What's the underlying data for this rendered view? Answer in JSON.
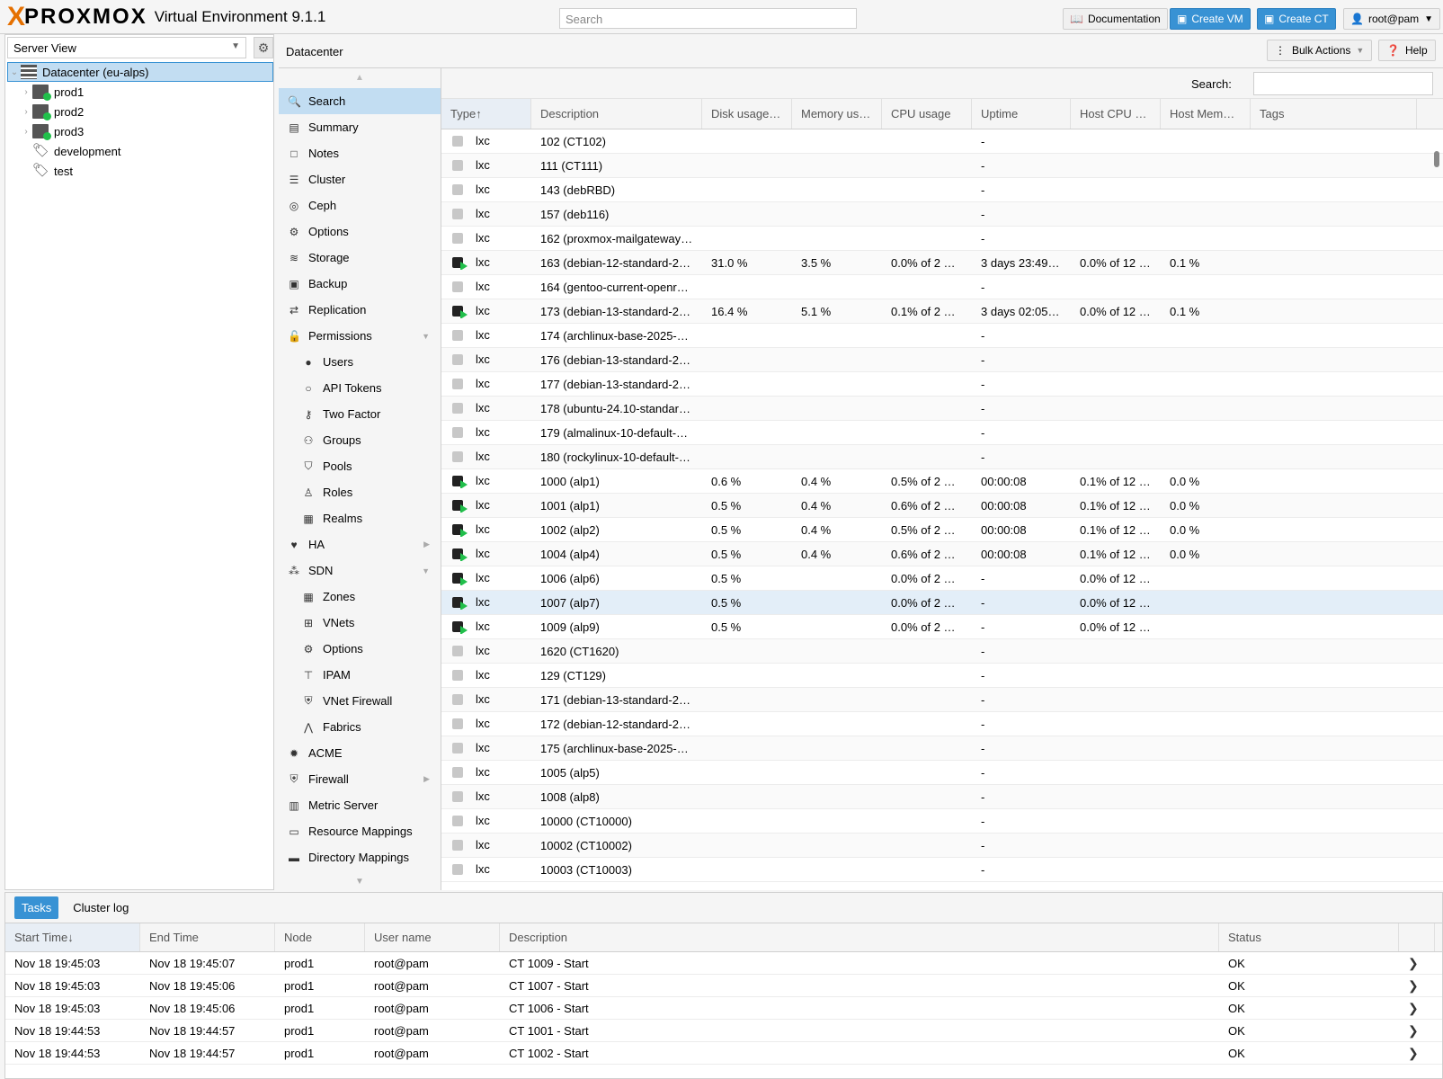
{
  "header": {
    "brand_x": "X",
    "brand": "PROXMOX",
    "product": "Virtual Environment 9.1.1",
    "search_placeholder": "Search",
    "documentation": "Documentation",
    "create_vm": "Create VM",
    "create_ct": "Create CT",
    "user": "root@pam"
  },
  "left": {
    "view": "Server View",
    "tree": [
      {
        "label": "Datacenter (eu-alps)",
        "type": "datacenter"
      },
      {
        "label": "prod1",
        "type": "node"
      },
      {
        "label": "prod2",
        "type": "node"
      },
      {
        "label": "prod3",
        "type": "node"
      },
      {
        "label": "development",
        "type": "tag"
      },
      {
        "label": "test",
        "type": "tag"
      }
    ]
  },
  "center": {
    "title": "Datacenter",
    "bulk_actions": "Bulk Actions",
    "help": "Help"
  },
  "menu": [
    {
      "label": "Search",
      "icon": "search-icon",
      "sel": true
    },
    {
      "label": "Summary",
      "icon": "book-icon"
    },
    {
      "label": "Notes",
      "icon": "notes-icon"
    },
    {
      "label": "Cluster",
      "icon": "server-icon"
    },
    {
      "label": "Ceph",
      "icon": "ceph-icon"
    },
    {
      "label": "Options",
      "icon": "gear-icon"
    },
    {
      "label": "Storage",
      "icon": "database-icon"
    },
    {
      "label": "Backup",
      "icon": "floppy-icon"
    },
    {
      "label": "Replication",
      "icon": "retweet-icon"
    },
    {
      "label": "Permissions",
      "icon": "unlock-icon",
      "tri": "down"
    },
    {
      "label": "Users",
      "icon": "user-icon",
      "sub": true
    },
    {
      "label": "API Tokens",
      "icon": "user-outline-icon",
      "sub": true
    },
    {
      "label": "Two Factor",
      "icon": "key-icon",
      "sub": true
    },
    {
      "label": "Groups",
      "icon": "users-icon",
      "sub": true
    },
    {
      "label": "Pools",
      "icon": "tags-icon",
      "sub": true
    },
    {
      "label": "Roles",
      "icon": "male-icon",
      "sub": true
    },
    {
      "label": "Realms",
      "icon": "id-card-icon",
      "sub": true
    },
    {
      "label": "HA",
      "icon": "heartbeat-icon",
      "tri": "right"
    },
    {
      "label": "SDN",
      "icon": "sdn-icon",
      "tri": "down"
    },
    {
      "label": "Zones",
      "icon": "grid-icon",
      "sub": true
    },
    {
      "label": "VNets",
      "icon": "network-icon",
      "sub": true
    },
    {
      "label": "Options",
      "icon": "gear-icon",
      "sub": true
    },
    {
      "label": "IPAM",
      "icon": "signpost-icon",
      "sub": true
    },
    {
      "label": "VNet Firewall",
      "icon": "shield-icon",
      "sub": true
    },
    {
      "label": "Fabrics",
      "icon": "road-icon",
      "sub": true
    },
    {
      "label": "ACME",
      "icon": "certificate-icon"
    },
    {
      "label": "Firewall",
      "icon": "shield-icon",
      "tri": "right"
    },
    {
      "label": "Metric Server",
      "icon": "chart-icon"
    },
    {
      "label": "Resource Mappings",
      "icon": "folder-icon"
    },
    {
      "label": "Directory Mappings",
      "icon": "folder-solid-icon"
    }
  ],
  "grid": {
    "search_label": "Search:",
    "columns": [
      "Type",
      "Description",
      "Disk usage…",
      "Memory us…",
      "CPU usage",
      "Uptime",
      "Host CPU …",
      "Host Mem…",
      "Tags"
    ],
    "rows": [
      {
        "run": false,
        "type": "lxc",
        "desc": "102 (CT102)",
        "disk": "",
        "mem": "",
        "cpu": "",
        "up": "-",
        "hcpu": "",
        "hmem": ""
      },
      {
        "run": false,
        "type": "lxc",
        "desc": "111 (CT111)",
        "disk": "",
        "mem": "",
        "cpu": "",
        "up": "-",
        "hcpu": "",
        "hmem": ""
      },
      {
        "run": false,
        "type": "lxc",
        "desc": "143 (debRBD)",
        "disk": "",
        "mem": "",
        "cpu": "",
        "up": "-",
        "hcpu": "",
        "hmem": ""
      },
      {
        "run": false,
        "type": "lxc",
        "desc": "157 (deb116)",
        "disk": "",
        "mem": "",
        "cpu": "",
        "up": "-",
        "hcpu": "",
        "hmem": ""
      },
      {
        "run": false,
        "type": "lxc",
        "desc": "162 (proxmox-mailgateway-…",
        "disk": "",
        "mem": "",
        "cpu": "",
        "up": "-",
        "hcpu": "",
        "hmem": ""
      },
      {
        "run": true,
        "type": "lxc",
        "desc": "163 (debian-12-standard-20…",
        "disk": "31.0 %",
        "mem": "3.5 %",
        "cpu": "0.0% of 2 …",
        "up": "3 days 23:49…",
        "hcpu": "0.0% of 12 …",
        "hmem": "0.1 %"
      },
      {
        "run": false,
        "type": "lxc",
        "desc": "164 (gentoo-current-openrc-…",
        "disk": "",
        "mem": "",
        "cpu": "",
        "up": "-",
        "hcpu": "",
        "hmem": ""
      },
      {
        "run": true,
        "type": "lxc",
        "desc": "173 (debian-13-standard-20…",
        "disk": "16.4 %",
        "mem": "5.1 %",
        "cpu": "0.1% of 2 …",
        "up": "3 days 02:05…",
        "hcpu": "0.0% of 12 …",
        "hmem": "0.1 %"
      },
      {
        "run": false,
        "type": "lxc",
        "desc": "174 (archlinux-base-2025-09…",
        "disk": "",
        "mem": "",
        "cpu": "",
        "up": "-",
        "hcpu": "",
        "hmem": ""
      },
      {
        "run": false,
        "type": "lxc",
        "desc": "176 (debian-13-standard-20…",
        "disk": "",
        "mem": "",
        "cpu": "",
        "up": "-",
        "hcpu": "",
        "hmem": ""
      },
      {
        "run": false,
        "type": "lxc",
        "desc": "177 (debian-13-standard-20…",
        "disk": "",
        "mem": "",
        "cpu": "",
        "up": "-",
        "hcpu": "",
        "hmem": ""
      },
      {
        "run": false,
        "type": "lxc",
        "desc": "178 (ubuntu-24.10-standard-…",
        "disk": "",
        "mem": "",
        "cpu": "",
        "up": "-",
        "hcpu": "",
        "hmem": ""
      },
      {
        "run": false,
        "type": "lxc",
        "desc": "179 (almalinux-10-default-20…",
        "disk": "",
        "mem": "",
        "cpu": "",
        "up": "-",
        "hcpu": "",
        "hmem": ""
      },
      {
        "run": false,
        "type": "lxc",
        "desc": "180 (rockylinux-10-default-2…",
        "disk": "",
        "mem": "",
        "cpu": "",
        "up": "-",
        "hcpu": "",
        "hmem": ""
      },
      {
        "run": true,
        "type": "lxc",
        "desc": "1000 (alp1)",
        "disk": "0.6 %",
        "mem": "0.4 %",
        "cpu": "0.5% of 2 …",
        "up": "00:00:08",
        "hcpu": "0.1% of 12 …",
        "hmem": "0.0 %"
      },
      {
        "run": true,
        "type": "lxc",
        "desc": "1001 (alp1)",
        "disk": "0.5 %",
        "mem": "0.4 %",
        "cpu": "0.6% of 2 …",
        "up": "00:00:08",
        "hcpu": "0.1% of 12 …",
        "hmem": "0.0 %"
      },
      {
        "run": true,
        "type": "lxc",
        "desc": "1002 (alp2)",
        "disk": "0.5 %",
        "mem": "0.4 %",
        "cpu": "0.5% of 2 …",
        "up": "00:00:08",
        "hcpu": "0.1% of 12 …",
        "hmem": "0.0 %"
      },
      {
        "run": true,
        "type": "lxc",
        "desc": "1004 (alp4)",
        "disk": "0.5 %",
        "mem": "0.4 %",
        "cpu": "0.6% of 2 …",
        "up": "00:00:08",
        "hcpu": "0.1% of 12 …",
        "hmem": "0.0 %"
      },
      {
        "run": true,
        "type": "lxc",
        "desc": "1006 (alp6)",
        "disk": "0.5 %",
        "mem": "",
        "cpu": "0.0% of 2 …",
        "up": "-",
        "hcpu": "0.0% of 12 …",
        "hmem": ""
      },
      {
        "run": true,
        "type": "lxc",
        "desc": "1007 (alp7)",
        "disk": "0.5 %",
        "mem": "",
        "cpu": "0.0% of 2 …",
        "up": "-",
        "hcpu": "0.0% of 12 …",
        "hmem": "",
        "sel": true
      },
      {
        "run": true,
        "type": "lxc",
        "desc": "1009 (alp9)",
        "disk": "0.5 %",
        "mem": "",
        "cpu": "0.0% of 2 …",
        "up": "-",
        "hcpu": "0.0% of 12 …",
        "hmem": ""
      },
      {
        "run": false,
        "type": "lxc",
        "desc": "1620 (CT1620)",
        "disk": "",
        "mem": "",
        "cpu": "",
        "up": "-",
        "hcpu": "",
        "hmem": ""
      },
      {
        "run": false,
        "type": "lxc",
        "desc": "129 (CT129)",
        "disk": "",
        "mem": "",
        "cpu": "",
        "up": "-",
        "hcpu": "",
        "hmem": ""
      },
      {
        "run": false,
        "type": "lxc",
        "desc": "171 (debian-13-standard-20…",
        "disk": "",
        "mem": "",
        "cpu": "",
        "up": "-",
        "hcpu": "",
        "hmem": ""
      },
      {
        "run": false,
        "type": "lxc",
        "desc": "172 (debian-12-standard-20…",
        "disk": "",
        "mem": "",
        "cpu": "",
        "up": "-",
        "hcpu": "",
        "hmem": ""
      },
      {
        "run": false,
        "type": "lxc",
        "desc": "175 (archlinux-base-2025-09…",
        "disk": "",
        "mem": "",
        "cpu": "",
        "up": "-",
        "hcpu": "",
        "hmem": ""
      },
      {
        "run": false,
        "type": "lxc",
        "desc": "1005 (alp5)",
        "disk": "",
        "mem": "",
        "cpu": "",
        "up": "-",
        "hcpu": "",
        "hmem": ""
      },
      {
        "run": false,
        "type": "lxc",
        "desc": "1008 (alp8)",
        "disk": "",
        "mem": "",
        "cpu": "",
        "up": "-",
        "hcpu": "",
        "hmem": ""
      },
      {
        "run": false,
        "type": "lxc",
        "desc": "10000 (CT10000)",
        "disk": "",
        "mem": "",
        "cpu": "",
        "up": "-",
        "hcpu": "",
        "hmem": ""
      },
      {
        "run": false,
        "type": "lxc",
        "desc": "10002 (CT10002)",
        "disk": "",
        "mem": "",
        "cpu": "",
        "up": "-",
        "hcpu": "",
        "hmem": ""
      },
      {
        "run": false,
        "type": "lxc",
        "desc": "10003 (CT10003)",
        "disk": "",
        "mem": "",
        "cpu": "",
        "up": "-",
        "hcpu": "",
        "hmem": ""
      }
    ]
  },
  "tasks": {
    "tabs": [
      "Tasks",
      "Cluster log"
    ],
    "columns": [
      "Start Time",
      "End Time",
      "Node",
      "User name",
      "Description",
      "Status"
    ],
    "rows": [
      {
        "start": "Nov 18 19:45:03",
        "end": "Nov 18 19:45:07",
        "node": "prod1",
        "user": "root@pam",
        "desc": "CT 1009 - Start",
        "status": "OK"
      },
      {
        "start": "Nov 18 19:45:03",
        "end": "Nov 18 19:45:06",
        "node": "prod1",
        "user": "root@pam",
        "desc": "CT 1007 - Start",
        "status": "OK"
      },
      {
        "start": "Nov 18 19:45:03",
        "end": "Nov 18 19:45:06",
        "node": "prod1",
        "user": "root@pam",
        "desc": "CT 1006 - Start",
        "status": "OK"
      },
      {
        "start": "Nov 18 19:44:53",
        "end": "Nov 18 19:44:57",
        "node": "prod1",
        "user": "root@pam",
        "desc": "CT 1001 - Start",
        "status": "OK"
      },
      {
        "start": "Nov 18 19:44:53",
        "end": "Nov 18 19:44:57",
        "node": "prod1",
        "user": "root@pam",
        "desc": "CT 1002 - Start",
        "status": "OK"
      }
    ]
  }
}
